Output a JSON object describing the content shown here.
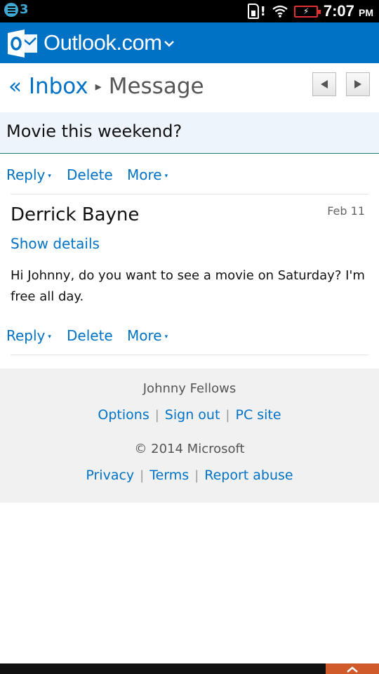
{
  "status_bar": {
    "notification_count": "3",
    "time": "7:07",
    "ampm": "PM",
    "alert": "!",
    "icons": [
      "notification-icon",
      "sim-card-icon",
      "wifi-icon",
      "battery-charging-icon"
    ]
  },
  "header": {
    "brand": "Outlook.com",
    "brand_color": "#0072c6",
    "icons": [
      "outlook-logo-icon",
      "chevron-down-icon"
    ]
  },
  "breadcrumb": {
    "back_label": "« Inbox",
    "separator": "▸",
    "current": "Message"
  },
  "pager": {
    "icons": [
      "arrow-left-icon",
      "arrow-right-icon"
    ]
  },
  "message": {
    "subject": "Movie this weekend?",
    "sender": "Derrick Bayne",
    "date": "Feb 11",
    "show_details": "Show details",
    "body": "Hi Johnny, do you want to see a movie on Saturday?  I'm free all day."
  },
  "actions": {
    "reply": "Reply",
    "delete": "Delete",
    "more": "More",
    "caret": "▾"
  },
  "footer": {
    "user": "Johnny Fellows",
    "links_1": [
      "Options",
      "Sign out",
      "PC site"
    ],
    "copyright": "© 2014 Microsoft",
    "links_2": [
      "Privacy",
      "Terms",
      "Report abuse"
    ],
    "separator": "|"
  }
}
